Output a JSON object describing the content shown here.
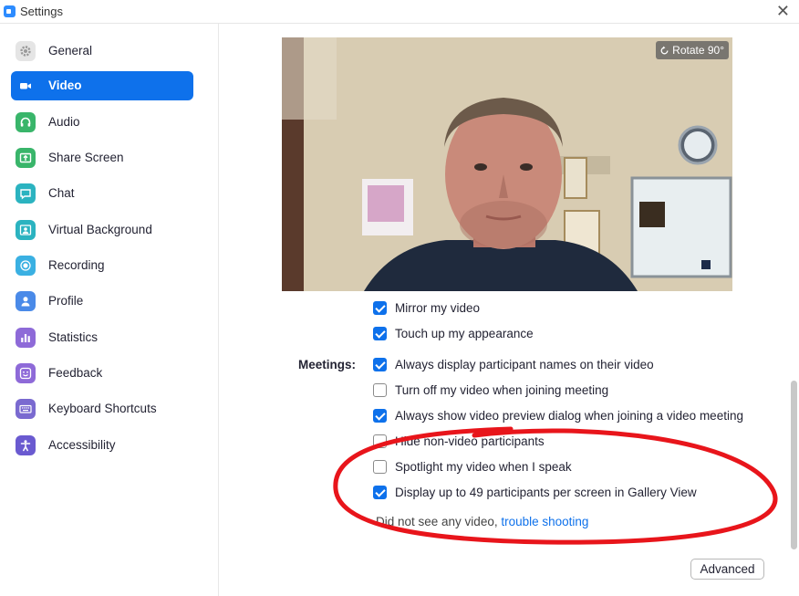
{
  "window": {
    "title": "Settings"
  },
  "sidebar": {
    "items": [
      {
        "label": "General",
        "icon": "gear-icon",
        "color": "#e5e5e5"
      },
      {
        "label": "Video",
        "icon": "video-camera-icon",
        "color": "#0e71eb",
        "active": true
      },
      {
        "label": "Audio",
        "icon": "headphones-icon",
        "color": "#39b56a"
      },
      {
        "label": "Share Screen",
        "icon": "share-screen-icon",
        "color": "#39b56a"
      },
      {
        "label": "Chat",
        "icon": "chat-bubble-icon",
        "color": "#2bb3c0"
      },
      {
        "label": "Virtual Background",
        "icon": "person-portrait-icon",
        "color": "#2bb3c0"
      },
      {
        "label": "Recording",
        "icon": "record-icon",
        "color": "#3ab0e2"
      },
      {
        "label": "Profile",
        "icon": "profile-icon",
        "color": "#4a8ae8"
      },
      {
        "label": "Statistics",
        "icon": "bar-stats-icon",
        "color": "#8e6ad8"
      },
      {
        "label": "Feedback",
        "icon": "smiley-icon",
        "color": "#8e6ad8"
      },
      {
        "label": "Keyboard Shortcuts",
        "icon": "keyboard-icon",
        "color": "#7a6ad0"
      },
      {
        "label": "Accessibility",
        "icon": "accessibility-icon",
        "color": "#6a5ad0"
      }
    ]
  },
  "video": {
    "rotate_label": "Rotate 90°",
    "meetings_label": "Meetings:",
    "options": [
      {
        "label": "Mirror my video",
        "checked": true
      },
      {
        "label": "Touch up my appearance",
        "checked": true
      },
      {
        "label": "Always display participant names on their video",
        "checked": true
      },
      {
        "label": "Turn off my video when joining meeting",
        "checked": false
      },
      {
        "label": "Always show video preview dialog when joining a video meeting",
        "checked": true
      },
      {
        "label": "Hide non-video participants",
        "checked": false
      },
      {
        "label": "Spotlight my video when I speak",
        "checked": false
      },
      {
        "label": "Display up to 49 participants per screen in Gallery View",
        "checked": true
      }
    ],
    "help_text": "Did not see any video,",
    "help_link": "trouble shooting",
    "advanced_label": "Advanced"
  },
  "colors": {
    "accent": "#0e71eb",
    "annotation": "#e8151b"
  }
}
